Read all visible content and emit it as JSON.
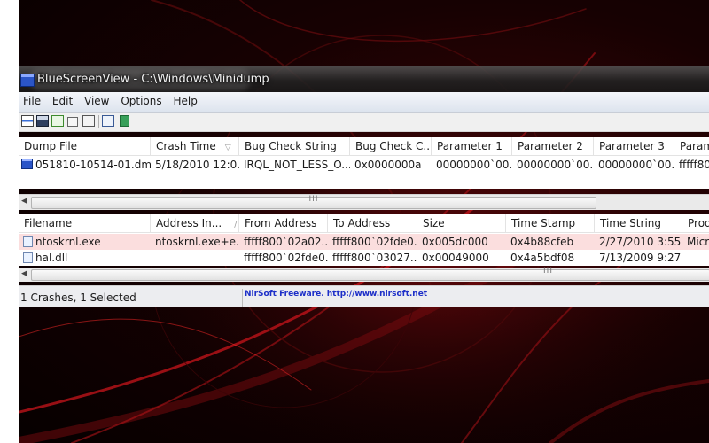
{
  "window": {
    "title": "BlueScreenView  -  C:\\Windows\\Minidump"
  },
  "menu": [
    "File",
    "Edit",
    "View",
    "Options",
    "Help"
  ],
  "toolbar": {
    "icons": [
      "properties-icon",
      "save-icon",
      "refresh-icon",
      "copy-icon",
      "html-report-icon",
      "find-icon",
      "exit-icon"
    ]
  },
  "dump_table": {
    "columns": [
      "Dump File",
      "Crash Time",
      "Bug Check String",
      "Bug Check C...",
      "Parameter 1",
      "Parameter 2",
      "Parameter 3",
      "Param"
    ],
    "rows": [
      [
        "051810-10514-01.dmp",
        "5/18/2010 12:0...",
        "IRQL_NOT_LESS_O...",
        "0x0000000a",
        "00000000`00...",
        "00000000`00...",
        "00000000`00...",
        "fffff80"
      ]
    ]
  },
  "driver_table": {
    "columns": [
      "Filename",
      "Address In...",
      "From Address",
      "To Address",
      "Size",
      "Time Stamp",
      "Time String",
      "Prod"
    ],
    "rows": [
      [
        "ntoskrnl.exe",
        "ntoskrnl.exe+e...",
        "fffff800`02a02...",
        "fffff800`02fde0...",
        "0x005dc000",
        "0x4b88cfeb",
        "2/27/2010 3:55...",
        "Micr"
      ],
      [
        "hal.dll",
        "",
        "fffff800`02fde0...",
        "fffff800`03027...",
        "0x00049000",
        "0x4a5bdf08",
        "7/13/2009 9:27...",
        ""
      ]
    ]
  },
  "scroll": {
    "grip": "III"
  },
  "status": {
    "summary": "1 Crashes, 1 Selected",
    "link": "NirSoft Freeware.  http://www.nirsoft.net"
  },
  "colors": {
    "selected_row": "#fbdede",
    "link": "#1d2fc8"
  }
}
